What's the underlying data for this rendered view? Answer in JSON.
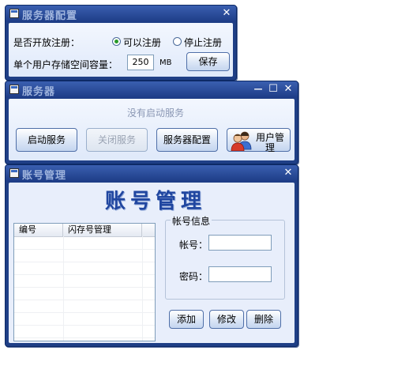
{
  "config_window": {
    "title": "服务器配置",
    "close_glyph": "✕",
    "register_label": "是否开放注册：",
    "radio_allow_label": "可以注册",
    "radio_stop_label": "停止注册",
    "radio_selected": "allow",
    "storage_label": "单个用户存储空间容量：",
    "storage_value": "250",
    "storage_unit": "MB",
    "save_label": "保存"
  },
  "server_window": {
    "title": "服务器",
    "minimize_glyph": "—",
    "maximize_glyph": "☐",
    "close_glyph": "✕",
    "status_text": "没有启动服务",
    "start_label": "启动服务",
    "stop_label": "关闭服务",
    "config_label": "服务器配置",
    "users_label_line1": "用户管",
    "users_label_line2": "理"
  },
  "account_window": {
    "title": "账号管理",
    "close_glyph": "✕",
    "heading": "账号管理",
    "table_headers": [
      "编号",
      "闪存号管理"
    ],
    "table_rows": [],
    "group_caption": "帐号信息",
    "account_label": "帐号：",
    "account_value": "",
    "password_label": "密码：",
    "password_value": "",
    "add_label": "添加",
    "edit_label": "修改",
    "delete_label": "删除"
  },
  "icons": {
    "window_icon": "app-window-icon",
    "users_icon": "users-icon"
  },
  "colors": {
    "title_bar": "#1d3c86",
    "client_bg": "#e8eefb",
    "heading": "#2046a0"
  }
}
